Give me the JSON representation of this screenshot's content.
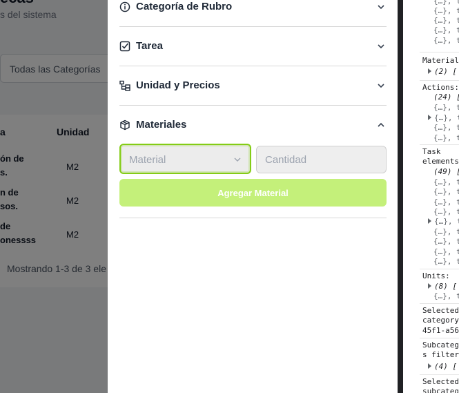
{
  "background_page": {
    "title": "ecas",
    "subtitle": "s del sistema",
    "category_filter": "Todas las Categorías",
    "table": {
      "headers": [
        "a",
        "Unidad"
      ],
      "rows": [
        {
          "name_line1": "ón de",
          "name_line2": "s.",
          "unit": "M2"
        },
        {
          "name_line1": "n de",
          "name_line2": "sos.",
          "unit": "M2"
        },
        {
          "name_line1": "de",
          "name_line2": "onessss",
          "unit": "M2"
        }
      ]
    },
    "footer": "Mostrando 1-3 de 3 ele"
  },
  "drawer": {
    "sections": [
      {
        "label": "Categoría de Rubro",
        "icon": "info-circle-icon",
        "expanded": false
      },
      {
        "label": "Tarea",
        "icon": "checkbox-icon",
        "expanded": false
      },
      {
        "label": "Unidad y Precios",
        "icon": "hierarchy-icon",
        "expanded": false
      },
      {
        "label": "Materiales",
        "icon": "package-icon",
        "expanded": true
      }
    ],
    "material_select": {
      "placeholder": "Material"
    },
    "quantity_input": {
      "placeholder": "Cantidad"
    },
    "add_button": "Agregar Material"
  },
  "console": {
    "lines": [
      "{…}, t",
      "{…}, t",
      "{…}, t",
      "{…}, t",
      "{…}, t",
      "Material",
      "(2) [",
      "Actions:",
      "(24) [",
      "{…}, t",
      "{…}, t",
      "{…}, t",
      "{…}, t",
      "Task",
      "elements",
      "(49) [",
      "{…}, t",
      "{…}, t",
      "{…}, t",
      "{…}, t",
      "{…}, t",
      "{…}, t",
      "{…}, t",
      "{…}, t",
      "{…}, t",
      "Units:",
      "(8) [",
      "{…}, t",
      "Selected",
      "category",
      "45f1-a56",
      "Subcateg",
      "s filter",
      "(4) [",
      "Selected",
      "subcateg"
    ]
  },
  "colors": {
    "accent_green": "#84cc16",
    "button_green": "#c4f07a",
    "overlay": "rgba(0,0,0,0.5)"
  }
}
